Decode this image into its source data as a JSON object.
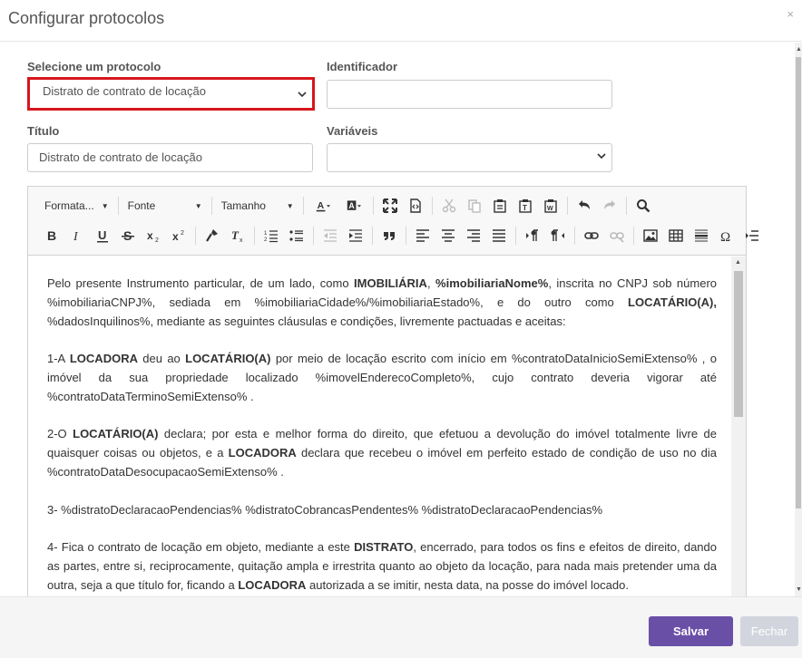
{
  "modal": {
    "title": "Configurar protocolos",
    "close_icon": "×"
  },
  "form": {
    "protocol_label": "Selecione um protocolo",
    "protocol_value": "Distrato de contrato de locação",
    "identifier_label": "Identificador",
    "identifier_value": "",
    "title_label": "Título",
    "title_value": "Distrato de contrato de locação",
    "variables_label": "Variáveis",
    "variables_value": ""
  },
  "toolbar": {
    "format_label": "Formata...",
    "font_label": "Fonte",
    "size_label": "Tamanho",
    "icons_row1": [
      "font-color-icon",
      "background-color-icon",
      "maximize-icon",
      "source-icon",
      "cut-icon",
      "copy-icon",
      "paste-icon",
      "paste-text-icon",
      "paste-word-icon",
      "undo-icon",
      "redo-icon",
      "find-icon"
    ],
    "icons_row2": [
      "bold-icon",
      "italic-icon",
      "underline-icon",
      "strikethrough-icon",
      "subscript-icon",
      "superscript-icon",
      "copy-format-icon",
      "remove-format-icon",
      "numbered-list-icon",
      "bulleted-list-icon",
      "outdent-icon",
      "indent-icon",
      "blockquote-icon",
      "align-left-icon",
      "align-center-icon",
      "align-right-icon",
      "justify-icon",
      "ltr-icon",
      "rtl-icon",
      "link-icon",
      "unlink-icon",
      "image-icon",
      "table-icon",
      "horizontal-line-icon",
      "special-char-icon",
      "page-break-icon"
    ]
  },
  "content": {
    "p1": {
      "a": "Pelo presente Instrumento particular, de um lado, como ",
      "b": "IMOBILIÁRIA",
      "c": ", ",
      "d": "%imobiliariaNome%",
      "e": ", inscrita no CNPJ sob número %imobiliariaCNPJ%, sediada em %imobiliariaCidade%/%imobiliariaEstado%, e do outro como ",
      "f": "LOCATÁRIO(A),",
      "g": " %dadosInquilinos%, mediante as seguintes cláusulas e condições, livremente pactuadas e aceitas:"
    },
    "p2": {
      "a": "1-A ",
      "b": "LOCADORA",
      "c": " deu ao ",
      "d": "LOCATÁRIO(A)",
      "e": " por meio de locação escrito com início em %contratoDataInicioSemiExtenso% , o imóvel da sua propriedade localizado %imovelEnderecoCompleto%, cujo contrato deveria vigorar até %contratoDataTerminoSemiExtenso% ."
    },
    "p3": {
      "a": "2-O ",
      "b": "LOCATÁRIO(A)",
      "c": " declara; por esta e melhor forma do direito, que efetuou a devolução do imóvel totalmente livre de quaisquer coisas ou objetos, e a ",
      "d": "LOCADORA",
      "e": " declara que recebeu o imóvel em perfeito estado de condição de uso no dia %contratoDataDesocupacaoSemiExtenso% ."
    },
    "p4": "3- %distratoDeclaracaoPendencias% %distratoCobrancasPendentes% %distratoDeclaracaoPendencias%",
    "p5": {
      "a": "4- Fica o contrato de locação em objeto, mediante a este ",
      "b": "DISTRATO",
      "c": ", encerrado, para todos os fins e efeitos de direito, dando as partes, entre si, reciprocamente, quitação ampla e irrestrita quanto ao objeto da locação, para nada mais pretender uma da outra, seja a que título for, ficando a ",
      "d": "LOCADORA",
      "e": " autorizada a se imitir, nesta data, na posse do imóvel locado."
    }
  },
  "footer": {
    "save_label": "Salvar",
    "close_label": "Fechar"
  },
  "colors": {
    "primary": "#6a4fa7",
    "highlight_border": "#d6161c",
    "disabled_button": "#d2d5dd"
  }
}
